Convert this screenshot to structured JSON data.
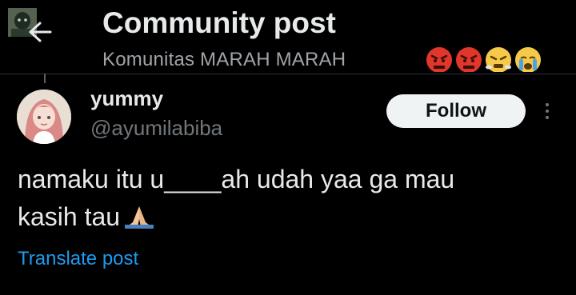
{
  "header": {
    "title": "Community post",
    "community_name": "Komunitas MARAH MARAH",
    "emojis": [
      "angry-face-icon",
      "angry-face-icon",
      "steam-face-icon",
      "crying-face-icon"
    ]
  },
  "post": {
    "author": {
      "display_name": "yummy",
      "handle": "@ayumilabiba"
    },
    "follow_label": "Follow",
    "text_line1": "namaku itu u____ah udah yaa ga mau",
    "text_line2": "kasih tau",
    "text_emoji": "praying-hands-icon",
    "translate_label": "Translate post"
  },
  "colors": {
    "background": "#000000",
    "primary_text": "#e7e9ea",
    "secondary_text": "#71767b",
    "link": "#1d9bf0",
    "follow_bg": "#eff3f4"
  }
}
